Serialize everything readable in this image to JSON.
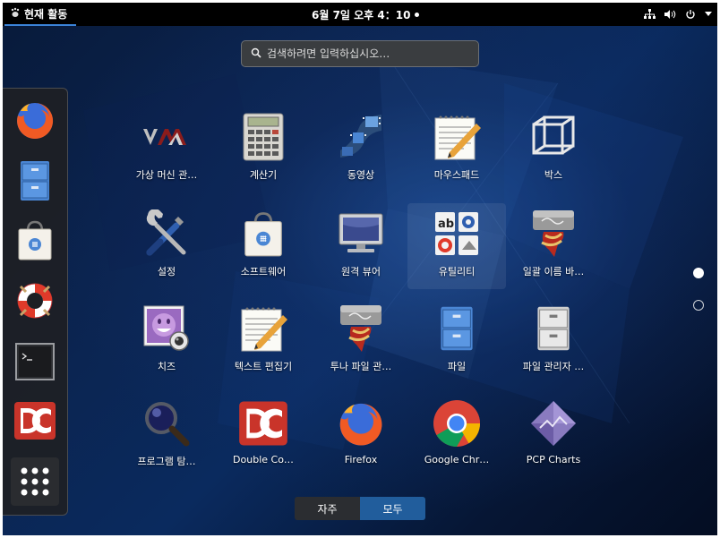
{
  "topbar": {
    "activities": "현재 활동",
    "clock": "6월 7일 오후 4：10"
  },
  "search": {
    "placeholder": "검색하려면 입력하십시오…"
  },
  "dash": {
    "items": [
      "firefox-icon",
      "file-cabinet-icon",
      "software-bag-icon",
      "lifebuoy-help-icon",
      "terminal-icon",
      "double-commander-icon",
      "show-apps-grid-icon"
    ]
  },
  "apps": [
    {
      "label": "가상 머신 관…",
      "icon": "vmm-icon"
    },
    {
      "label": "계산기",
      "icon": "calculator-icon"
    },
    {
      "label": "동영상",
      "icon": "video-film-icon"
    },
    {
      "label": "마우스패드",
      "icon": "notepad-pencil-icon"
    },
    {
      "label": "박스",
      "icon": "cube-box-icon"
    },
    {
      "label": "설정",
      "icon": "tools-settings-icon"
    },
    {
      "label": "소프트웨어",
      "icon": "software-bag-icon"
    },
    {
      "label": "원격 뷰어",
      "icon": "monitor-icon"
    },
    {
      "label": "유틸리티",
      "icon": "utilities-folder-icon"
    },
    {
      "label": "일괄 이름 바…",
      "icon": "archive-scroll-icon"
    },
    {
      "label": "치즈",
      "icon": "cheese-webcam-icon"
    },
    {
      "label": "텍스트 편집기",
      "icon": "text-editor-icon"
    },
    {
      "label": "투나 파일 관…",
      "icon": "archive-scroll-icon"
    },
    {
      "label": "파일",
      "icon": "file-cabinet-icon"
    },
    {
      "label": "파일 관리자 …",
      "icon": "file-cabinet-grey-icon"
    },
    {
      "label": "프로그램 탐…",
      "icon": "magnifier-icon"
    },
    {
      "label": "Double Co…",
      "icon": "double-commander-icon"
    },
    {
      "label": "Firefox",
      "icon": "firefox-icon"
    },
    {
      "label": "Google Chr…",
      "icon": "chrome-icon"
    },
    {
      "label": "PCP Charts",
      "icon": "pcp-charts-icon"
    }
  ],
  "toggle": {
    "frequent": "자주",
    "all": "모두"
  },
  "colors": {
    "accent": "#215d9c",
    "topbar": "#000000",
    "activities_underline": "#3b83d8"
  }
}
